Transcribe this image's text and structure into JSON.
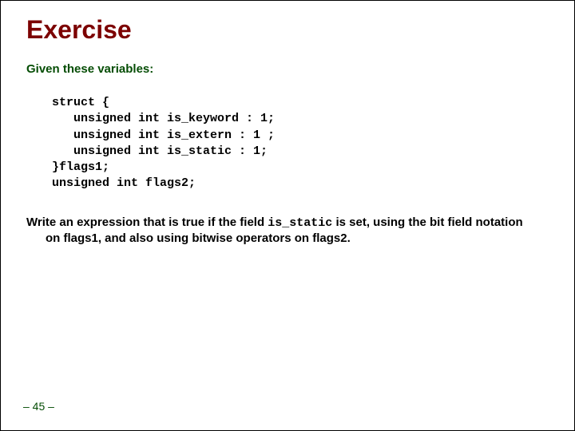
{
  "title": "Exercise",
  "intro": "Given these variables:",
  "code": "struct {\n   unsigned int is_keyword : 1;\n   unsigned int is_extern : 1 ;\n   unsigned int is_static : 1;\n}flags1;\nunsigned int flags2;",
  "question_p1": "Write an expression that is true if the field ",
  "question_code": "is_static",
  "question_p2": " is set, using the bit field notation on flags1, and also using bitwise operators on flags2.",
  "pagenum": "– 45 –"
}
